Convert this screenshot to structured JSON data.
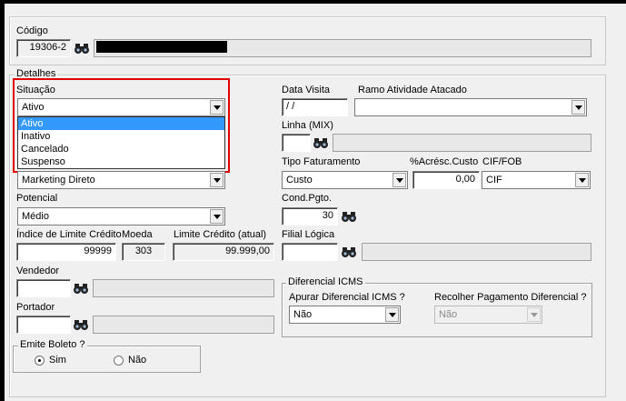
{
  "codigo": {
    "label": "Código",
    "value": "19306-2"
  },
  "detalhes": {
    "title": "Detalhes"
  },
  "situacao": {
    "label": "Situação",
    "value": "Ativo",
    "options": [
      "Ativo",
      "Inativo",
      "Cancelado",
      "Suspenso"
    ]
  },
  "data_visita": {
    "label": "Data Visita",
    "value": " /  /"
  },
  "ramo": {
    "label": "Ramo Atividade Atacado",
    "value": ""
  },
  "linha": {
    "label": "Linha (MIX)",
    "value": ""
  },
  "canal": {
    "value": "Marketing Direto"
  },
  "tipo_faturamento": {
    "label": "Tipo Faturamento",
    "value": "Custo"
  },
  "acresc": {
    "label": "%Acrésc.Custo",
    "value": "0,00"
  },
  "cif": {
    "label": "CIF/FOB",
    "value": "CIF"
  },
  "potencial": {
    "label": "Potencial",
    "value": "Médio"
  },
  "cond_pgto": {
    "label": "Cond.Pgto.",
    "value": "30"
  },
  "indice": {
    "label": "Índice de Limite Crédito",
    "value": "99999"
  },
  "moeda": {
    "label": "Moeda",
    "value": "303"
  },
  "limite": {
    "label": "Limite Crédito (atual)",
    "value": "99.999,00"
  },
  "filial": {
    "label": "Filial Lógica",
    "value": ""
  },
  "vendedor": {
    "label": "Vendedor",
    "value": ""
  },
  "portador": {
    "label": "Portador",
    "value": ""
  },
  "diferencial": {
    "title": "Diferencial ICMS",
    "apurar_label": "Apurar Diferencial ICMS ?",
    "apurar_value": "Não",
    "recolher_label": "Recolher Pagamento Diferencial ?",
    "recolher_value": "Não"
  },
  "boleto": {
    "title": "Emite Boleto ?",
    "sim": "Sim",
    "nao": "Não",
    "selected": "Sim"
  },
  "icons": {
    "lookup": "binoculars-icon",
    "dropdown": "chevron-down-icon"
  },
  "colors": {
    "highlight": "#3399ff",
    "annotation": "#e00000",
    "background": "#f0f0f0"
  }
}
